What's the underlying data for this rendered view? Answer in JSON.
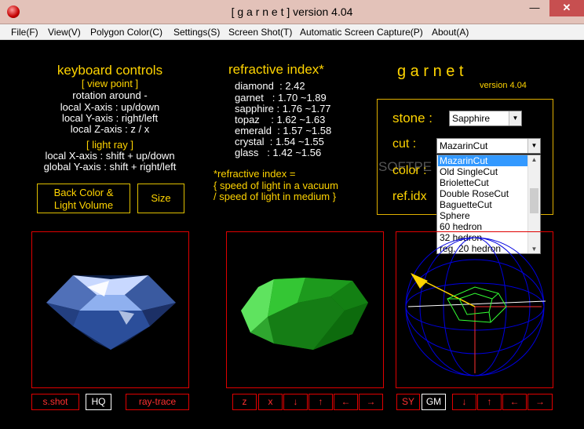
{
  "window": {
    "title": "[ g a r n e t ] version 4.04",
    "close": "✕",
    "minimize": "—",
    "maximize": "☐"
  },
  "menu": [
    "File(F)",
    "View(V)",
    "Polygon Color(C)",
    "Settings(S)",
    "Screen Shot(T)",
    "Automatic Screen Capture(P)",
    "About(A)"
  ],
  "keyboard": {
    "heading": "keyboard controls",
    "view_point": "[ view point ]",
    "rotation": "rotation around -",
    "x_axis": "local X-axis : up/down",
    "y_axis": "local Y-axis : right/left",
    "z_axis": "local Z-axis : z / x",
    "light_ray": "[ light ray ]",
    "light_x": "local X-axis : shift + up/down",
    "light_y": "global Y-axis : shift + right/left"
  },
  "buttons": {
    "back_color": "Back Color &",
    "light_volume": "Light Volume",
    "size": "Size"
  },
  "refractive": {
    "heading": "refractive index*",
    "rows": [
      {
        "name": "diamond",
        "value": ": 2.42"
      },
      {
        "name": "garnet",
        "value": ": 1.70 ~1.89"
      },
      {
        "name": "sapphire",
        "value": ": 1.76 ~1.77"
      },
      {
        "name": "topaz",
        "value": ": 1.62 ~1.63"
      },
      {
        "name": "emerald",
        "value": ": 1.57 ~1.58"
      },
      {
        "name": "crystal",
        "value": ": 1.54 ~1.55"
      },
      {
        "name": "glass",
        "value": ": 1.42 ~1.56"
      }
    ],
    "note1": "*refractive index =",
    "note2": "{ speed of light in a vacuum",
    "note3": "/ speed of light in medium }"
  },
  "brand": {
    "name": "g a r n e t",
    "version": "version 4.04"
  },
  "stone_panel": {
    "stone_label": "stone :",
    "stone_value": "Sapphire",
    "cut_label": "cut :",
    "cut_value": "MazarinCut",
    "color_label": "color :",
    "refidx_label": "ref.idx"
  },
  "cut_options": [
    "MazarinCut",
    "Old SingleCut",
    "BrioletteCut",
    "Double RoseCut",
    "BaguetteCut",
    "Sphere",
    "60 hedron",
    "32 hedron",
    "reg. 20 hedron"
  ],
  "watermark": "SOFTPE",
  "panel1_buttons": {
    "sshot": "s.shot",
    "hq": "HQ",
    "raytrace": "ray-trace"
  },
  "panel2_buttons": [
    "z",
    "x",
    "↓",
    "↑",
    "←",
    "→"
  ],
  "panel3_buttons": {
    "sy": "SY",
    "gm": "GM",
    "arrows": [
      "↓",
      "↑",
      "←",
      "→"
    ]
  },
  "colors": {
    "accent_yellow": "#ffd400",
    "panel_red": "#e00000",
    "close_red": "#c74f50"
  },
  "icons": {
    "app": "garnet-app-icon",
    "dropdown": "chevron-down-icon"
  }
}
